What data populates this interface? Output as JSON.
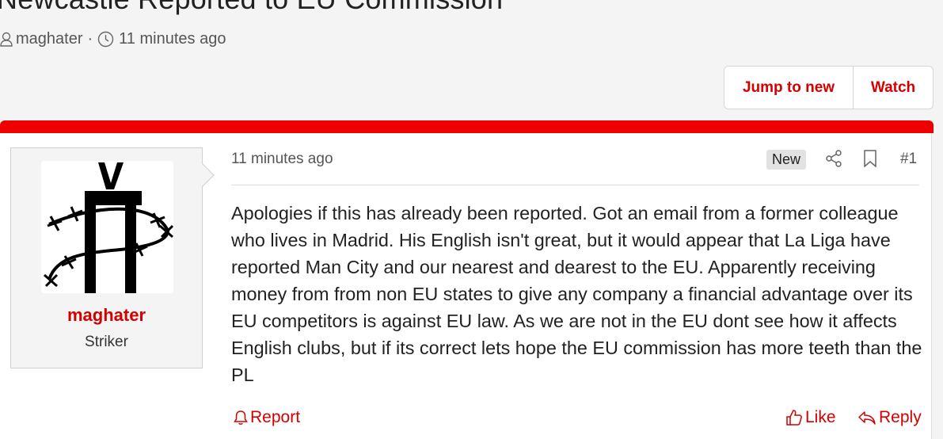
{
  "thread": {
    "title": "Newcastle Reported to EU Commission",
    "author": "maghater",
    "separator": "·",
    "time": "11 minutes ago"
  },
  "actions": {
    "jump_to_new": "Jump to new",
    "watch": "Watch"
  },
  "post": {
    "username": "maghater",
    "user_title": "Striker",
    "time": "11 minutes ago",
    "badge": "New",
    "number": "#1",
    "body": "Apologies if this has already been reported. Got an email from a former colleague who lives in Madrid. His English isn't great, but it would appear that La Liga have reported Man City and our nearest and dearest to the EU. Apparently receiving money from from non EU states to give any company a financial advantage over its EU competitors is against EU law. As we are not in the EU dont see how it affects English clubs, but if its correct lets hope the EU commission has more teeth than the PL",
    "report": "Report",
    "like": "Like",
    "reply": "Reply"
  },
  "colors": {
    "accent": "#d40000",
    "bar": "#ee0000",
    "background": "#f4f4f4"
  }
}
